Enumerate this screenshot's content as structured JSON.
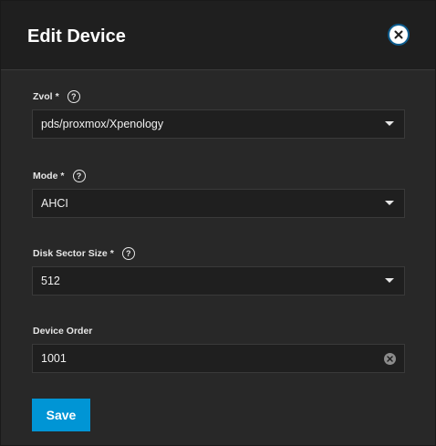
{
  "dialog": {
    "title": "Edit Device",
    "close_icon": "close-circle-icon"
  },
  "fields": {
    "zvol": {
      "label": "Zvol",
      "required_mark": "*",
      "help_icon": "help-circle-icon",
      "value": "pds/proxmox/Xpenology"
    },
    "mode": {
      "label": "Mode",
      "required_mark": "*",
      "help_icon": "help-circle-icon",
      "value": "AHCI"
    },
    "disk_sector_size": {
      "label": "Disk Sector Size",
      "required_mark": "*",
      "help_icon": "help-circle-icon",
      "value": "512"
    },
    "device_order": {
      "label": "Device Order",
      "value": "1001",
      "clear_icon": "clear-icon"
    }
  },
  "actions": {
    "save_label": "Save"
  },
  "colors": {
    "accent": "#0095d5",
    "background": "#282828",
    "header": "#1f1f1f"
  }
}
